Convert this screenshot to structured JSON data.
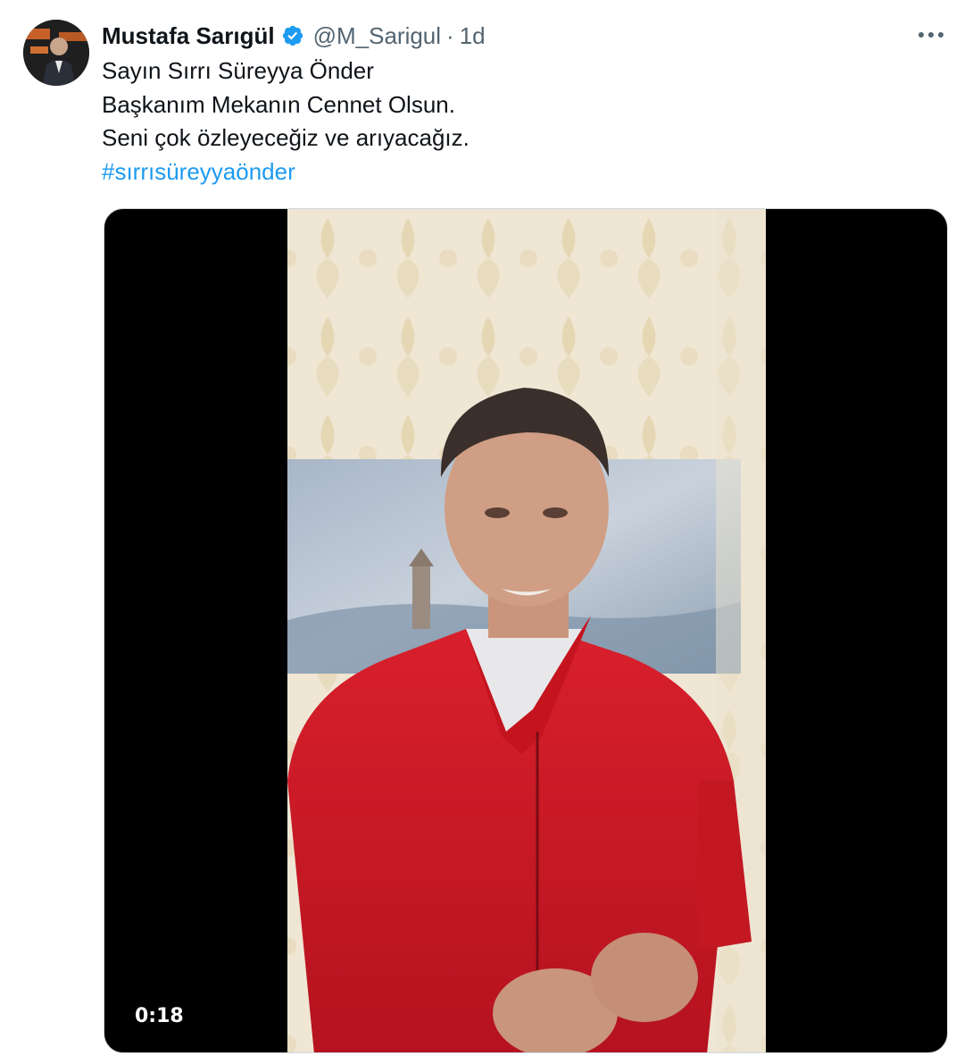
{
  "tweet": {
    "author": {
      "display_name": "Mustafa Sarıgül",
      "handle": "@M_Sarigul",
      "verified_icon": "verified-badge-icon",
      "avatar_icon": "avatar"
    },
    "separator": "·",
    "time": "1d",
    "more_icon": "more-dots-icon",
    "lines": [
      "Sayın Sırrı Süreyya Önder",
      "Başkanım Mekanın Cennet Olsun.",
      "Seni çok özleyeceğiz ve arıyacağız."
    ],
    "hashtag": "#sırrısüreyyaönder",
    "media": {
      "type": "video",
      "duration": "0:18"
    },
    "colors": {
      "link": "#1d9bf0",
      "verified": "#1d9bf0",
      "secondary_text": "#536471"
    }
  }
}
